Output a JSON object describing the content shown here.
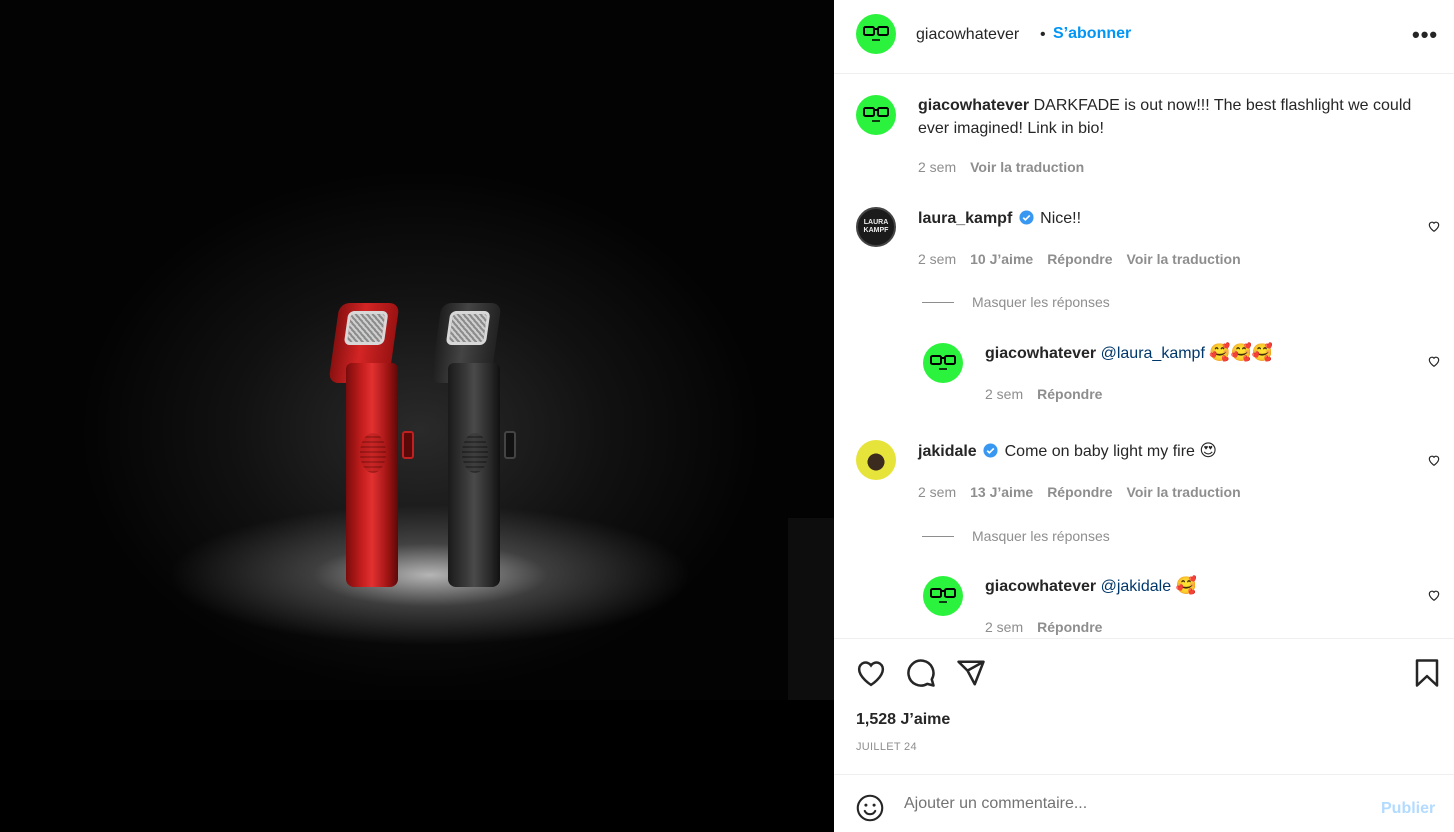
{
  "post": {
    "author": "giacowhatever",
    "separator": "•",
    "follow_label": "S’abonner",
    "more_label": "•••",
    "caption_text": "DARKFADE is out now!!! The best flashlight we could ever imagined! Link in bio!",
    "caption_time": "2 sem",
    "caption_translate": "Voir la traduction",
    "likes": "1,528 J’aime",
    "date": "JUILLET 24"
  },
  "comments": [
    {
      "user": "laura_kampf",
      "verified": true,
      "text": "Nice!!",
      "time": "2 sem",
      "likes": "10 J’aime",
      "reply_label": "Répondre",
      "translate": "Voir la traduction",
      "avatar_text": [
        "LAURA",
        "KAMPF"
      ],
      "hide_replies": "Masquer les réponses",
      "reply": {
        "user": "giacowhatever",
        "mention": "@laura_kampf",
        "emoji": "🥰🥰🥰",
        "time": "2 sem",
        "reply_label": "Répondre"
      }
    },
    {
      "user": "jakidale",
      "verified": true,
      "text": "Come on baby light my fire",
      "emoji": "😍",
      "time": "2 sem",
      "likes": "13 J’aime",
      "reply_label": "Répondre",
      "translate": "Voir la traduction",
      "hide_replies": "Masquer les réponses",
      "reply": {
        "user": "giacowhatever",
        "mention": "@jakidale",
        "emoji": "🥰",
        "time": "2 sem",
        "reply_label": "Répondre"
      }
    }
  ],
  "composer": {
    "placeholder": "Ajouter un commentaire...",
    "publish_label": "Publier"
  },
  "colors": {
    "avatar_green": "#2bf23d",
    "link_blue": "#0095f6",
    "mention": "#00376b",
    "muted": "#8e8e8e"
  },
  "icons": [
    "nerd-glasses-icon",
    "verified-icon",
    "heart-icon",
    "comment-icon",
    "share-icon",
    "bookmark-icon",
    "emoji-icon",
    "more-icon"
  ]
}
